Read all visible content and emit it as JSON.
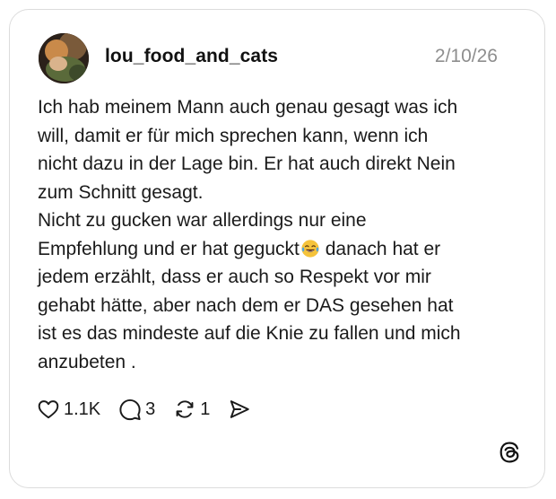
{
  "post": {
    "username": "lou_food_and_cats",
    "date": "2/10/26",
    "lines": [
      "Ich hab meinem Mann auch genau gesagt was ich",
      "will, damit er für mich sprechen kann, wenn ich",
      "nicht dazu in der Lage bin. Er hat auch direkt Nein",
      "zum Schnitt gesagt.",
      "Nicht zu gucken war allerdings nur eine",
      "Empfehlung und er hat geguckt",
      "danach hat er",
      "jedem erzählt, dass er auch so Respekt vor mir",
      "gehabt hätte, aber nach dem er DAS gesehen hat",
      "ist es das mindeste auf die Knie zu fallen und mich",
      "anzubeten ."
    ],
    "emoji": "face-with-tears-of-joy"
  },
  "actions": {
    "likes": "1.1K",
    "replies": "3",
    "reposts": "1"
  },
  "icons": {
    "like": "heart-icon",
    "reply": "speech-bubble-icon",
    "repost": "repost-icon",
    "share": "send-icon",
    "brand": "threads-logo-icon"
  }
}
